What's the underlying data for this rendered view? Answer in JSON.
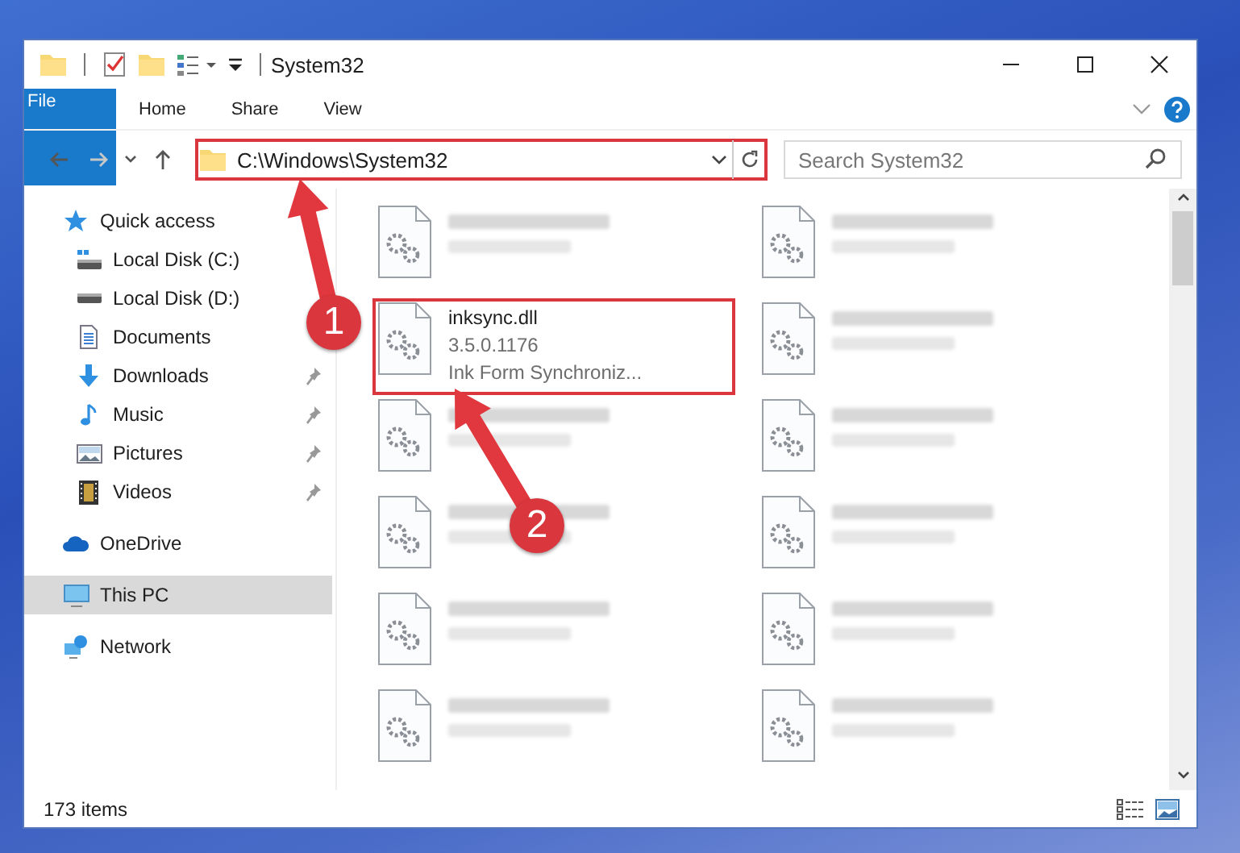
{
  "window": {
    "title": "System32"
  },
  "ribbon": {
    "tabs": [
      {
        "label": "File",
        "kind": "file"
      },
      {
        "label": "Home",
        "kind": "tab"
      },
      {
        "label": "Share",
        "kind": "tab"
      },
      {
        "label": "View",
        "kind": "tab"
      }
    ]
  },
  "navigation": [
    {
      "kind": "back",
      "disabled": false
    },
    {
      "kind": "forward",
      "disabled": true
    },
    {
      "kind": "recent",
      "disabled": false
    },
    {
      "kind": "up",
      "disabled": false
    }
  ],
  "address": {
    "path": "C:\\Windows\\System32",
    "highlighted": true
  },
  "search": {
    "placeholder": "Search System32"
  },
  "sidebar": {
    "items": [
      {
        "label": "Quick access",
        "kind": "star",
        "selected": false,
        "children": [
          {
            "label": "Local Disk (C:)",
            "kind": "sysdrive",
            "pinned": false,
            "selected": false
          },
          {
            "label": "Local Disk (D:)",
            "kind": "drive",
            "pinned": false,
            "selected": false
          },
          {
            "label": "Documents",
            "kind": "documents",
            "pinned": false,
            "selected": false
          },
          {
            "label": "Downloads",
            "kind": "downloads",
            "pinned": true,
            "selected": false
          },
          {
            "label": "Music",
            "kind": "music",
            "pinned": true,
            "selected": false
          },
          {
            "label": "Pictures",
            "kind": "pictures",
            "pinned": true,
            "selected": false
          },
          {
            "label": "Videos",
            "kind": "videos",
            "pinned": true,
            "selected": false
          }
        ]
      },
      {
        "label": "OneDrive",
        "kind": "cloud",
        "selected": false
      },
      {
        "label": "This PC",
        "kind": "pc",
        "selected": true
      },
      {
        "label": "Network",
        "kind": "network",
        "selected": false
      }
    ]
  },
  "files": [
    {
      "blurred": true,
      "highlighted": false
    },
    {
      "blurred": true,
      "highlighted": false
    },
    {
      "name": "inksync.dll",
      "lines": [
        "3.5.0.1176",
        "Ink Form Synchroniz..."
      ],
      "blurred": false,
      "highlighted": true
    },
    {
      "blurred": true,
      "highlighted": false
    },
    {
      "blurred": true,
      "highlighted": false
    },
    {
      "blurred": true,
      "highlighted": false
    },
    {
      "blurred": true,
      "highlighted": false
    },
    {
      "blurred": true,
      "highlighted": false
    },
    {
      "blurred": true,
      "highlighted": false
    },
    {
      "blurred": true,
      "highlighted": false
    },
    {
      "blurred": true,
      "highlighted": false
    },
    {
      "blurred": true,
      "highlighted": false
    }
  ],
  "status_bar": {
    "count": "173 items"
  },
  "annotations": [
    {
      "label": "1"
    },
    {
      "label": "2"
    }
  ]
}
